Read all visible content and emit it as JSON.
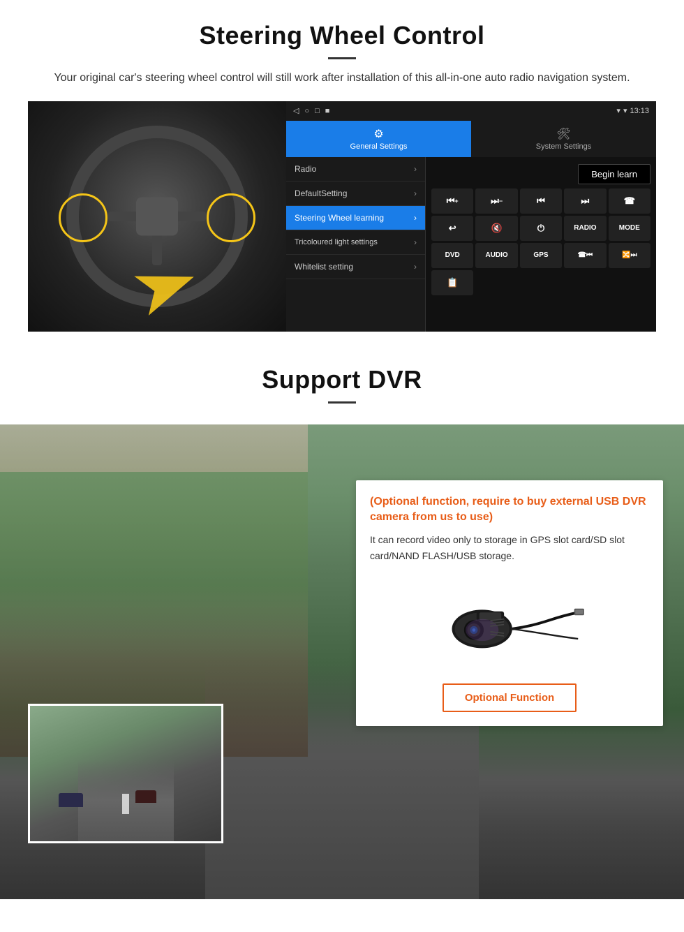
{
  "steering": {
    "title": "Steering Wheel Control",
    "subtitle": "Your original car's steering wheel control will still work after installation of this all-in-one auto radio navigation system.",
    "divider": "—",
    "android": {
      "statusbar": {
        "back": "◁",
        "home": "○",
        "square": "□",
        "record": "■",
        "signal": "▾",
        "wifi": "▾",
        "time": "13:13"
      },
      "tab_general": "General Settings",
      "tab_system": "System Settings",
      "menu_items": [
        {
          "label": "Radio",
          "active": false
        },
        {
          "label": "DefaultSetting",
          "active": false
        },
        {
          "label": "Steering Wheel learning",
          "active": true
        },
        {
          "label": "Tricoloured light settings",
          "active": false
        },
        {
          "label": "Whitelist setting",
          "active": false
        }
      ],
      "begin_learn": "Begin learn",
      "controls_row1": [
        "⏮+",
        "⏭−",
        "⏮⏮",
        "⏭⏭",
        "☎"
      ],
      "controls_row2": [
        "↩",
        "🔇",
        "⏻",
        "RADIO",
        "MODE"
      ],
      "controls_row3": [
        "DVD",
        "AUDIO",
        "GPS",
        "☎⏮",
        "🔀⏭"
      ],
      "controls_row4": [
        "📋"
      ]
    }
  },
  "dvr": {
    "title": "Support DVR",
    "info_title": "(Optional function, require to buy external USB DVR camera from us to use)",
    "info_text": "It can record video only to storage in GPS slot card/SD slot card/NAND FLASH/USB storage.",
    "optional_button": "Optional Function"
  }
}
